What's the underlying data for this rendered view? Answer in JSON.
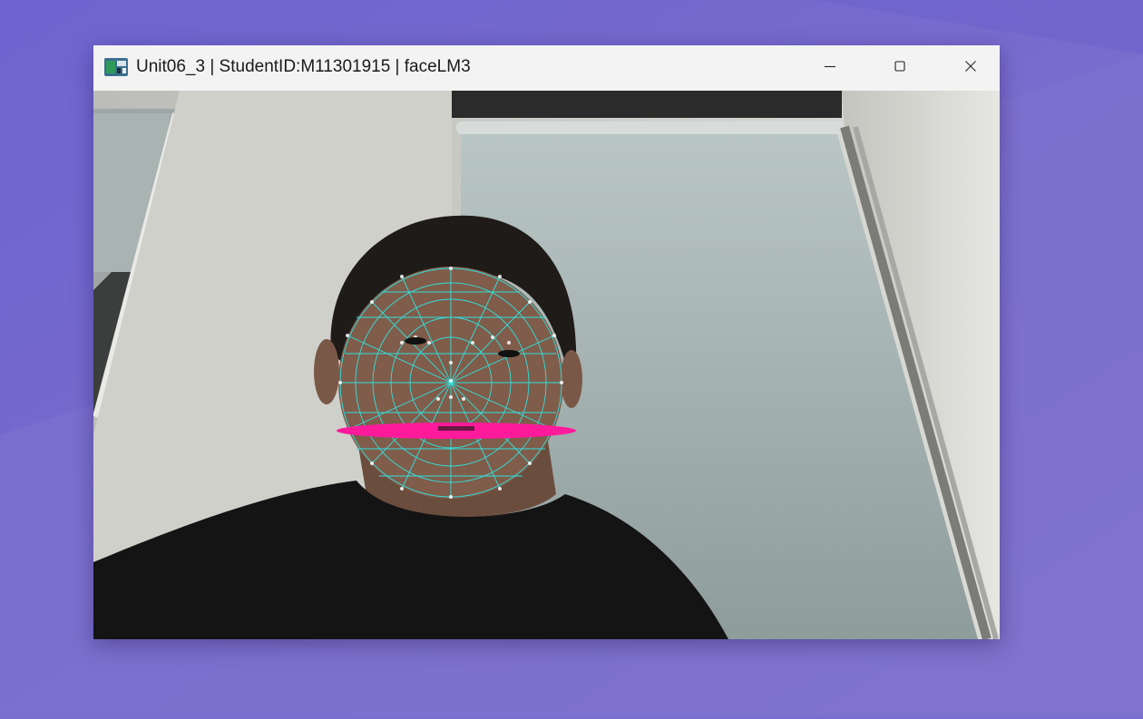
{
  "window": {
    "title": "Unit06_3 | StudentID:M11301915 | faceLM3",
    "app_icon": "opencv-window-icon",
    "controls": [
      "minimize-icon",
      "maximize-icon",
      "close-icon"
    ]
  },
  "colors": {
    "wallpaper": "#7a6fcf",
    "titlebar": "#f3f3f3",
    "mesh": "#2ee8e8",
    "lip_overlay": "#ff1a9c"
  },
  "camera_feed": {
    "content": "webcam frame with face mesh landmarks overlay"
  }
}
